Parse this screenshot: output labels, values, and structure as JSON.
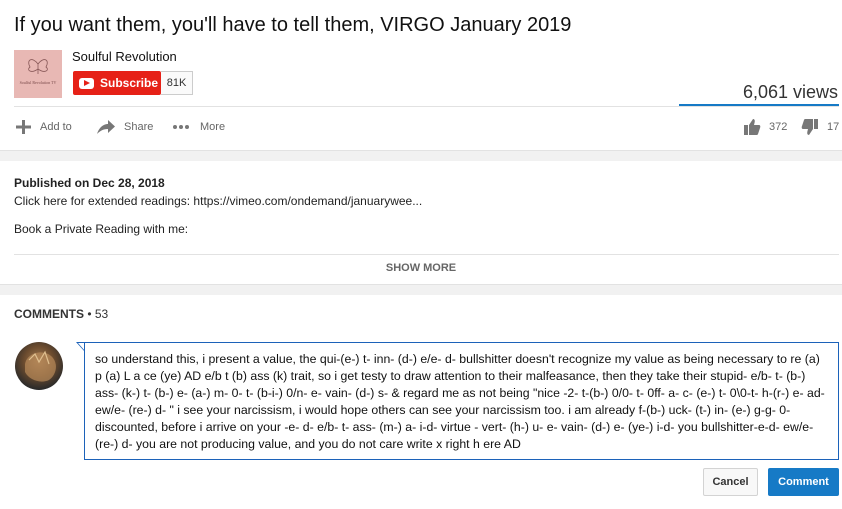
{
  "video": {
    "title": "If you want them, you'll have to tell them, VIRGO January 2019",
    "views": "6,061 views"
  },
  "channel": {
    "name": "Soulful Revolution",
    "logo_text": "Soulful Revolution TV",
    "subscribe_label": "Subscribe",
    "subscriber_count": "81K"
  },
  "actions": {
    "add_to": "Add to",
    "share": "Share",
    "more": "More",
    "likes": "372",
    "dislikes": "17"
  },
  "description": {
    "published": "Published on Dec 28, 2018",
    "line1": "Click here for extended readings: https://vimeo.com/ondemand/januarywee...",
    "line2": "Book a Private Reading with me:",
    "show_more": "SHOW MORE"
  },
  "comments": {
    "heading": "COMMENTS",
    "count": "53",
    "draft_text": "so understand this, i present a value, the qui-(e-) t-   inn- (d-) e/e- d-  bullshitter doesn't recognize my value as being necessary to re (a) p (a) L a ce (ye) AD e/b t (b) ass (k) trait,  so i get testy to draw attention to their malfeasance, then they take their stupid- e/b- t- (b-) ass- (k-) t- (b-) e- (a-) m- 0- t- (b-i-) 0/n- e- vain- (d-) s-  & regard me as not being \"nice -2- t-(b-) 0/0- t- 0ff- a- c- (e-) t- 0\\0-t- h-(r-) e- ad- ew/e- (re-) d- \"  i see your narcissism, i would hope others can see your narcissism too.  i am already f-(b-) uck- (t-) in- (e-) g-g-  0- discounted, before i arrive on your -e- d- e/b- t- ass- (m-) a- i-d- virtue - vert- (h-) u- e- vain- (d-) e- (ye-) i-d-  you bullshitter-e-d- ew/e- (re-) d-  you are not producing value, and you do not care write x right h ere AD",
    "cancel_label": "Cancel",
    "submit_label": "Comment"
  },
  "colors": {
    "subscribe": "#e62117",
    "accent_blue": "#167ac6",
    "focus_border": "#1c62b9"
  },
  "icons": [
    "plus-icon",
    "share-arrow-icon",
    "more-dots-icon",
    "thumbs-up-icon",
    "thumbs-down-icon",
    "youtube-play-icon"
  ]
}
